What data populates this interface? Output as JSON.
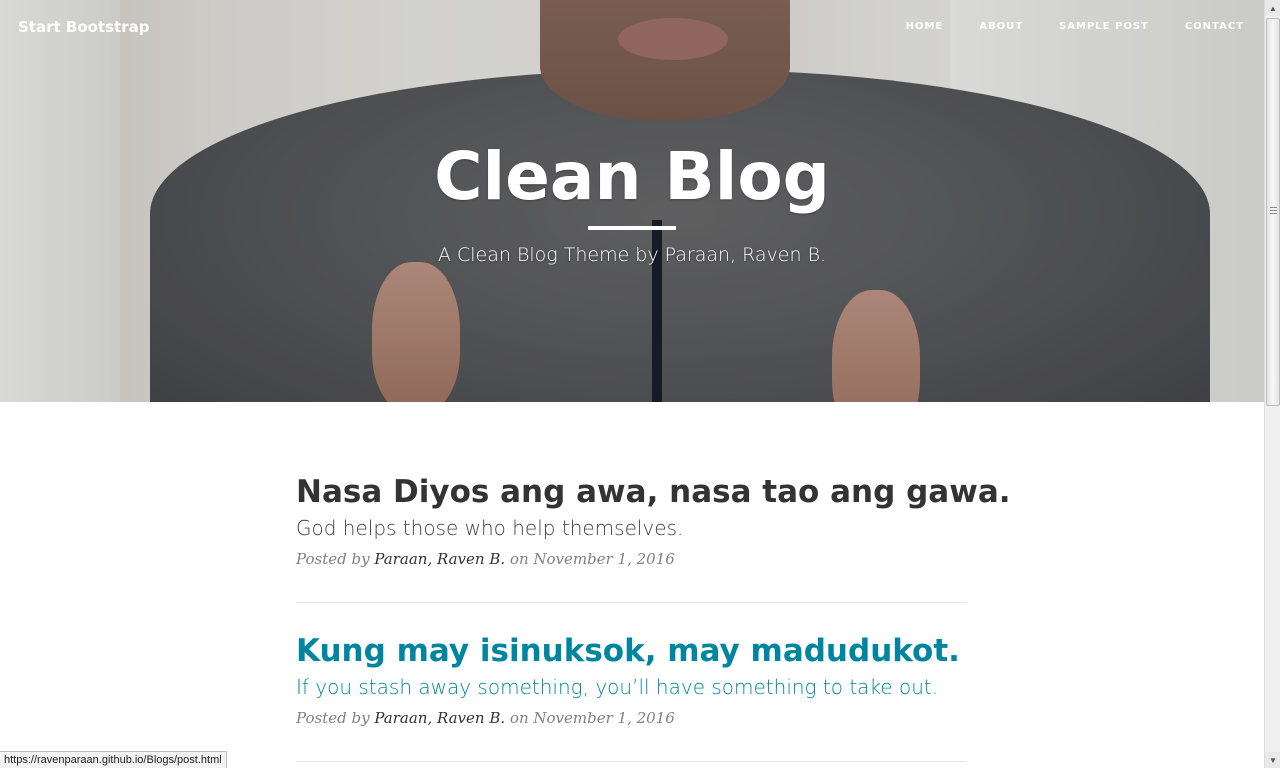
{
  "navbar": {
    "brand": "Start Bootstrap",
    "links": [
      "HOME",
      "ABOUT",
      "SAMPLE POST",
      "CONTACT"
    ]
  },
  "header": {
    "title": "Clean Blog",
    "subtitle": "A Clean Blog Theme by Paraan, Raven B."
  },
  "posts": [
    {
      "title": "Nasa Diyos ang awa, nasa tao ang gawa.",
      "subtitle": "God helps those who help themselves.",
      "meta_prefix": "Posted by",
      "author": "Paraan, Raven B.",
      "meta_on": "on November 1, 2016"
    },
    {
      "title": "Kung may isinuksok, may madudukot.",
      "subtitle": "If you stash away something, you’ll have something to take out.",
      "meta_prefix": "Posted by",
      "author": "Paraan, Raven B.",
      "meta_on": "on November 1, 2016"
    }
  ],
  "statusbar": {
    "url": "https://ravenparaan.github.io/Blogs/post.html"
  },
  "colors": {
    "link": "#0085a1",
    "heading_text": "#333333",
    "meta_text": "#808080"
  },
  "icons": [
    "scroll-up-arrow-icon",
    "scroll-down-arrow-icon"
  ]
}
